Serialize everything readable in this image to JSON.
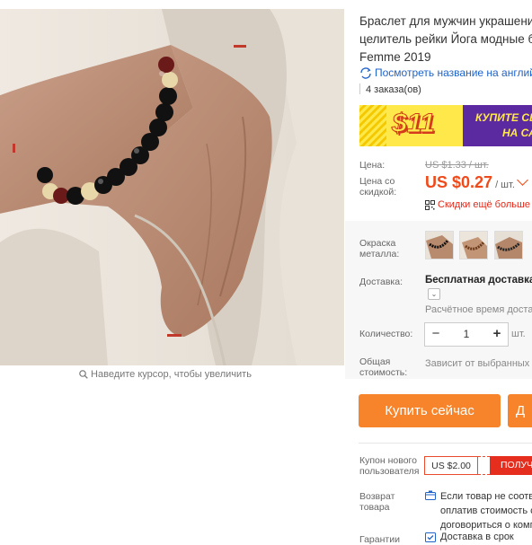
{
  "gallery": {
    "zoom_hint": "Наведите курсор, чтобы увеличить"
  },
  "product": {
    "title_lines": [
      "Браслет для мужчин украшени",
      "целитель рейки Йога модные б",
      "Femme 2019"
    ],
    "translate_link": "Посмотреть название на английс",
    "orders": "4 заказа(ов)"
  },
  "promo_banner": {
    "amount": "$11",
    "text_lines": [
      "КУПИТЕ СЕ",
      "НА СА"
    ]
  },
  "pricing": {
    "price_label": "Цена:",
    "old_price": "US $1.33 / шт.",
    "sale_label_lines": [
      "Цена со",
      "скидкой:"
    ],
    "sale_price": "US $0.27",
    "sale_unit": "/ шт.",
    "more_discounts": "Скидки ещё больше"
  },
  "options": {
    "color_label_lines": [
      "Окраска",
      "металла:"
    ],
    "shipping_label": "Доставка:",
    "shipping_value": "Бесплатная доставка в",
    "shipping_toggle": "⌄",
    "shipping_estimate": "Расчётное время доста",
    "quantity_label": "Количество:",
    "quantity_minus": "−",
    "quantity_value": "1",
    "quantity_plus": "+",
    "quantity_unit": "шт.",
    "total_label_lines": [
      "Общая",
      "стоимость:"
    ],
    "total_value": "Зависит от выбранных"
  },
  "actions": {
    "buy_now": "Купить сейчас",
    "add_cart": "Д"
  },
  "coupon": {
    "label_lines": [
      "Купон нового",
      "пользователя"
    ],
    "value": "US $2.00",
    "get_label": "ПОЛУЧ"
  },
  "returns": {
    "label_lines": [
      "Возврат",
      "товара"
    ],
    "text_lines": [
      "Если товар не соотв",
      "оплатив стоимость с",
      "договориться о комп"
    ]
  },
  "guarantee": {
    "label": "Гарантии",
    "text": "Доставка в срок"
  },
  "colors": {
    "accent": "#f7842a",
    "sale": "#f04a1a",
    "link": "#2063c9",
    "banner_purple": "#5b2aa0",
    "banner_yellow": "#ffe84a"
  }
}
